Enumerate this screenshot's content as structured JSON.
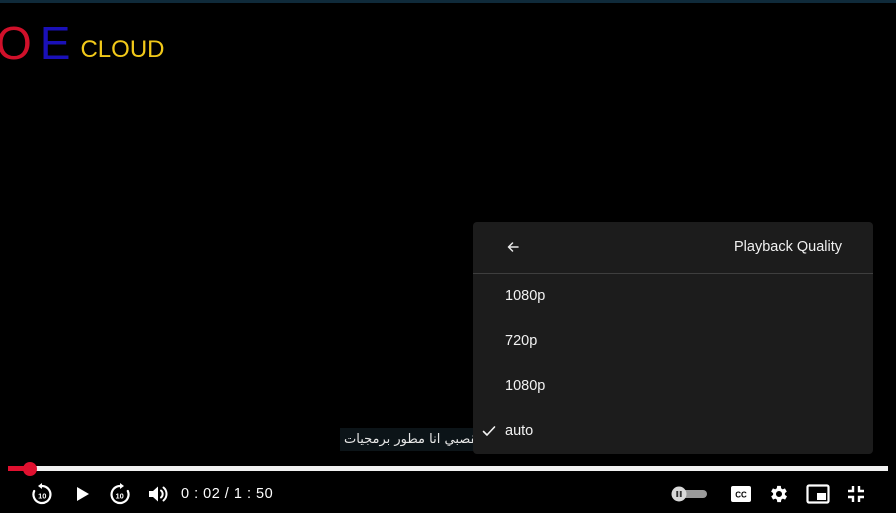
{
  "logo": {
    "letter_o": "O",
    "letter_e": "E",
    "cloud": "CLOUD"
  },
  "colors": {
    "logo_o": "#d0102a",
    "logo_e": "#1a10b8",
    "logo_cloud": "#f2c919",
    "accent": "#e0102f"
  },
  "subtitle": {
    "text": "مرحبا أنا محمد القصبي انا مطور برمجيات"
  },
  "quality_menu": {
    "back_icon": "arrow-left-icon",
    "title": "Playback Quality",
    "options": [
      {
        "label": "1080p",
        "selected": false
      },
      {
        "label": "720p",
        "selected": false
      },
      {
        "label": "1080p",
        "selected": false
      },
      {
        "label": "auto",
        "selected": true
      }
    ]
  },
  "player": {
    "current_time": "0 : 02",
    "separator": " / ",
    "duration": "1 : 50",
    "progress_fraction": 0.025,
    "controls": [
      "rewind-10-icon",
      "play-icon",
      "forward-10-icon",
      "volume-icon",
      "autoplay-toggle",
      "captions-icon",
      "settings-gear-icon",
      "picture-in-picture-icon",
      "exit-fullscreen-icon"
    ],
    "captions_label": "CC"
  }
}
